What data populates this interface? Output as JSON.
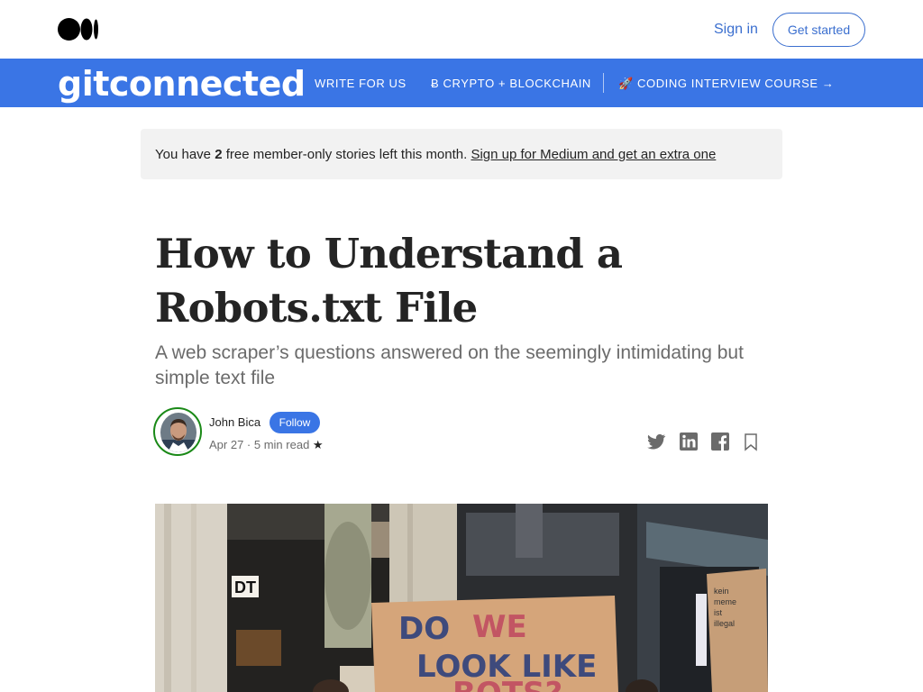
{
  "header": {
    "sign_in": "Sign in",
    "get_started": "Get started"
  },
  "publication": {
    "name": "gitconnected",
    "nav": [
      {
        "label": "WRITE FOR US"
      },
      {
        "label": "Ƀ CRYPTO + BLOCKCHAIN"
      },
      {
        "label": "🚀 CODING INTERVIEW COURSE →"
      }
    ],
    "brand_color": "#3a75e5"
  },
  "banner": {
    "prefix": "You have ",
    "count": "2",
    "suffix": " free member-only stories left this month. ",
    "link": "Sign up for Medium and get an extra one"
  },
  "article": {
    "title": "How to Understand a Robots.txt File",
    "subtitle": "A web scraper’s questions answered on the seemingly intimidating but simple text file",
    "author": "John Bica",
    "follow_label": "Follow",
    "date": "Apr 27",
    "read_time": "5 min read",
    "star": "★"
  },
  "share_icons": [
    "twitter-icon",
    "linkedin-icon",
    "facebook-icon",
    "bookmark-icon"
  ],
  "hero_sign": {
    "line1a": "DO",
    "line1b": "WE",
    "line2": "LOOK LIKE",
    "line3": "BOTS?"
  }
}
